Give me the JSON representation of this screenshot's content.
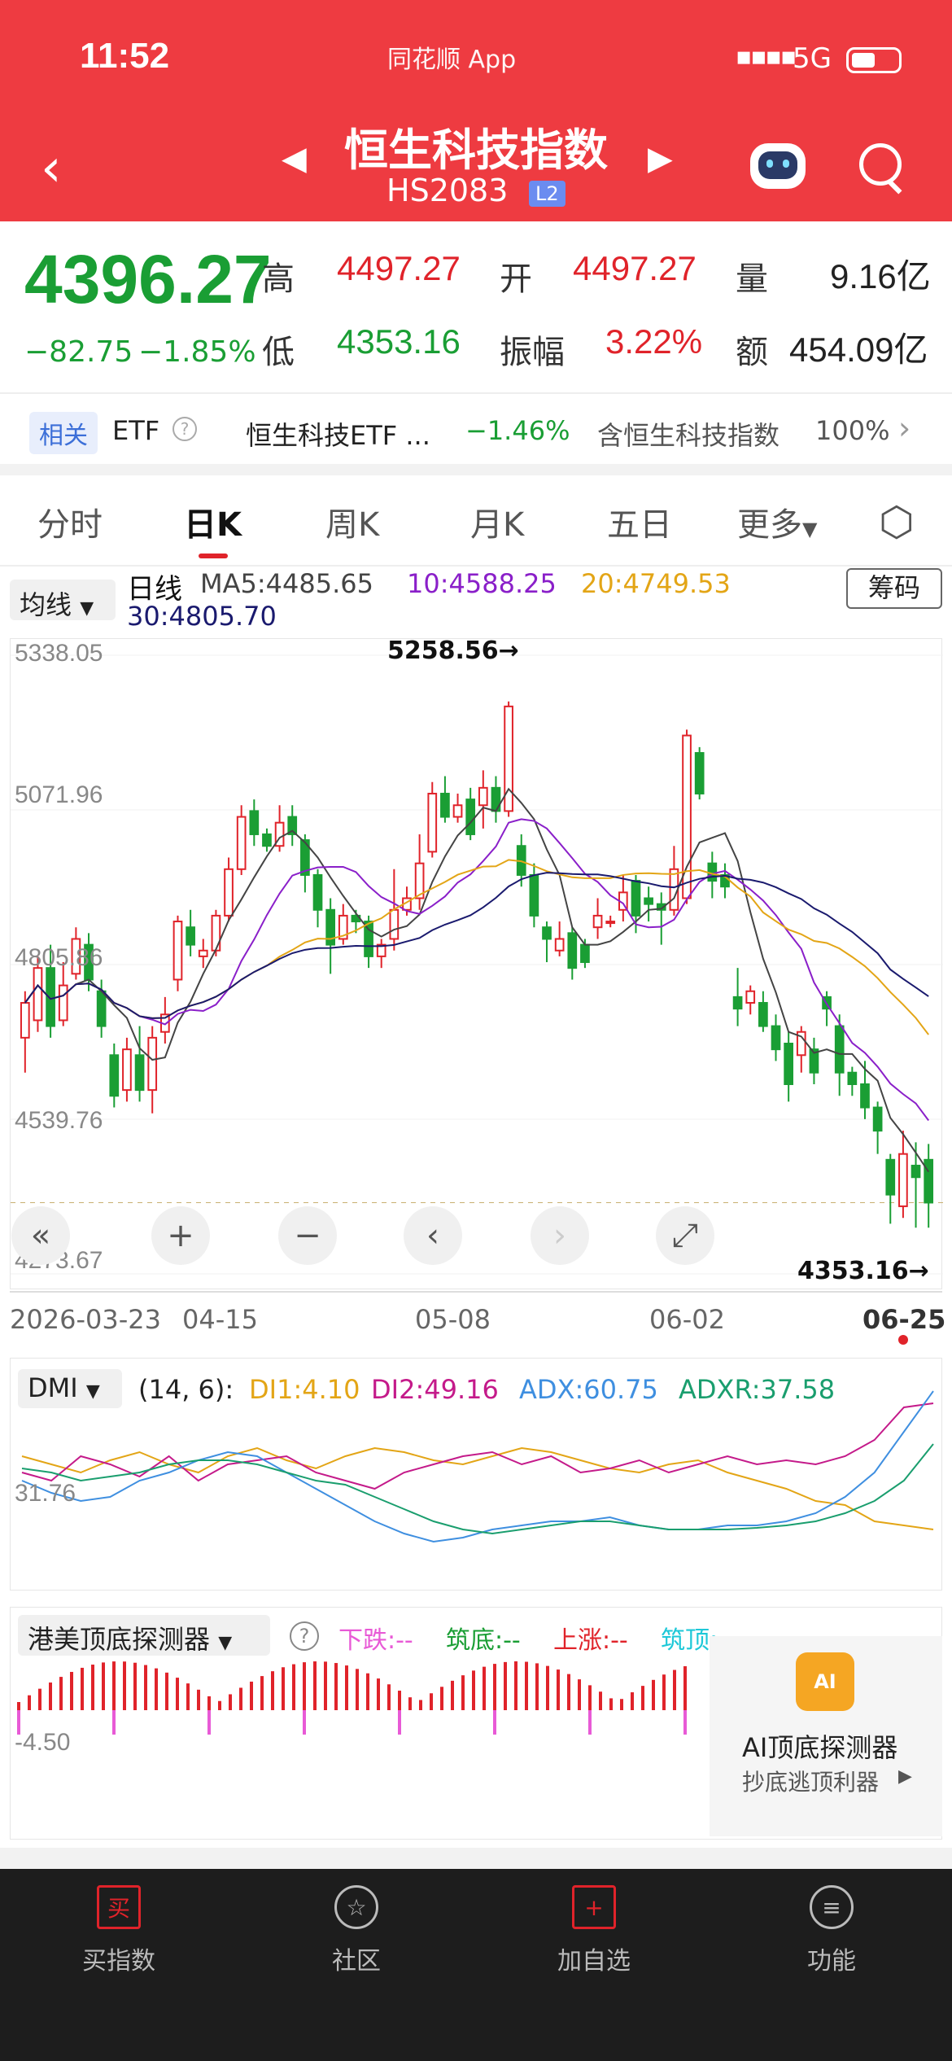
{
  "status": {
    "time": "11:52",
    "app_name": "同花顺 App",
    "network": "5G"
  },
  "header": {
    "title": "恒生科技指数",
    "code": "HS2083",
    "level_badge": "L2"
  },
  "quote": {
    "price": "4396.27",
    "change": "−82.75",
    "change_pct": "−1.85%",
    "high_label": "高",
    "high": "4497.27",
    "low_label": "低",
    "low": "4353.16",
    "open_label": "开",
    "open": "4497.27",
    "amp_label": "振幅",
    "amp": "3.22%",
    "vol_label": "量",
    "vol": "9.16亿",
    "amt_label": "额",
    "amt": "454.09亿"
  },
  "etf_row": {
    "tag": "相关",
    "etf_label": "ETF",
    "fund_name": "恒生科技ETF ...",
    "fund_change": "−1.46%",
    "holding_label": "含恒生科技指数",
    "holding_pct": "100%"
  },
  "tabs": [
    "分时",
    "日K",
    "周K",
    "月K",
    "五日",
    "更多"
  ],
  "ma_bar": {
    "select": "均线",
    "period": "日线",
    "ma5": "MA5:4485.65",
    "ma10": "10:4588.25",
    "ma20": "20:4749.53",
    "ma30": "30:4805.70",
    "chip_btn": "筹码"
  },
  "colors": {
    "up": "#e0232a",
    "down": "#1a9e34",
    "ma5": "#444444",
    "ma10": "#8a1fc9",
    "ma20": "#e3a516",
    "ma30": "#1a1a6e"
  },
  "chart_data": {
    "type": "candlestick",
    "y_ticks": [
      "5338.05",
      "5071.96",
      "4805.86",
      "4539.76",
      "4273.67"
    ],
    "ylim": [
      4273.67,
      5338.05
    ],
    "max_label": "5258.56→",
    "min_label": "4353.16→",
    "dates": [
      "2026-03-23",
      "04-15",
      "05-08",
      "06-02",
      "06-25"
    ],
    "candles": [
      [
        4680,
        4740,
        4620,
        4760
      ],
      [
        4710,
        4800,
        4690,
        4820
      ],
      [
        4800,
        4700,
        4680,
        4840
      ],
      [
        4710,
        4770,
        4700,
        4810
      ],
      [
        4790,
        4850,
        4780,
        4870
      ],
      [
        4840,
        4780,
        4760,
        4860
      ],
      [
        4760,
        4700,
        4680,
        4780
      ],
      [
        4650,
        4580,
        4560,
        4670
      ],
      [
        4590,
        4660,
        4570,
        4680
      ],
      [
        4650,
        4590,
        4570,
        4700
      ],
      [
        4590,
        4680,
        4550,
        4700
      ],
      [
        4690,
        4720,
        4670,
        4750
      ],
      [
        4780,
        4880,
        4760,
        4890
      ],
      [
        4870,
        4840,
        4820,
        4900
      ],
      [
        4820,
        4830,
        4800,
        4850
      ],
      [
        4830,
        4890,
        4820,
        4900
      ],
      [
        4890,
        4970,
        4880,
        4990
      ],
      [
        4970,
        5060,
        4960,
        5080
      ],
      [
        5070,
        5030,
        5010,
        5090
      ],
      [
        5030,
        5010,
        5000,
        5040
      ],
      [
        5010,
        5050,
        5000,
        5080
      ],
      [
        5060,
        5030,
        5010,
        5080
      ],
      [
        5020,
        4960,
        4930,
        5030
      ],
      [
        4960,
        4900,
        4870,
        4970
      ],
      [
        4900,
        4840,
        4790,
        4920
      ],
      [
        4850,
        4890,
        4840,
        4910
      ],
      [
        4890,
        4880,
        4860,
        4900
      ],
      [
        4880,
        4820,
        4800,
        4890
      ],
      [
        4820,
        4840,
        4800,
        4850
      ],
      [
        4850,
        4900,
        4830,
        4970
      ],
      [
        4900,
        4920,
        4890,
        4940
      ],
      [
        4920,
        4980,
        4900,
        5030
      ],
      [
        5000,
        5100,
        4990,
        5120
      ],
      [
        5100,
        5060,
        5050,
        5130
      ],
      [
        5060,
        5080,
        5050,
        5100
      ],
      [
        5090,
        5030,
        5020,
        5110
      ],
      [
        5080,
        5110,
        5040,
        5140
      ],
      [
        5110,
        5070,
        5050,
        5130
      ],
      [
        5070,
        5250,
        5060,
        5258.56
      ],
      [
        5010,
        4960,
        4940,
        5030
      ],
      [
        4960,
        4890,
        4870,
        4980
      ],
      [
        4870,
        4850,
        4810,
        4880
      ],
      [
        4830,
        4850,
        4820,
        4880
      ],
      [
        4860,
        4800,
        4780,
        4870
      ],
      [
        4840,
        4810,
        4800,
        4850
      ],
      [
        4870,
        4890,
        4850,
        4920
      ],
      [
        4880,
        4880,
        4870,
        4890
      ],
      [
        4900,
        4930,
        4880,
        4960
      ],
      [
        4950,
        4890,
        4860,
        4960
      ],
      [
        4920,
        4910,
        4880,
        4940
      ],
      [
        4910,
        4900,
        4840,
        4930
      ],
      [
        4900,
        4970,
        4890,
        5010
      ],
      [
        4920,
        5200,
        4910,
        5210
      ],
      [
        5170,
        5100,
        5090,
        5180
      ],
      [
        4980,
        4950,
        4920,
        5000
      ],
      [
        4960,
        4940,
        4920,
        4980
      ],
      [
        4750,
        4730,
        4700,
        4800
      ],
      [
        4740,
        4760,
        4720,
        4770
      ],
      [
        4740,
        4700,
        4690,
        4760
      ],
      [
        4700,
        4660,
        4640,
        4720
      ],
      [
        4670,
        4600,
        4570,
        4690
      ],
      [
        4650,
        4690,
        4620,
        4700
      ],
      [
        4660,
        4620,
        4600,
        4680
      ],
      [
        4750,
        4730,
        4700,
        4760
      ],
      [
        4700,
        4620,
        4580,
        4720
      ],
      [
        4620,
        4600,
        4580,
        4630
      ],
      [
        4600,
        4560,
        4540,
        4640
      ],
      [
        4560,
        4520,
        4480,
        4570
      ],
      [
        4470,
        4410,
        4360,
        4480
      ],
      [
        4390,
        4480,
        4370,
        4520
      ],
      [
        4460,
        4440,
        4353.16,
        4500
      ],
      [
        4470,
        4396.27,
        4353.16,
        4497.27
      ]
    ]
  },
  "chart_controls": {
    "zoom_in": "+",
    "zoom_out": "−"
  },
  "dmi": {
    "select": "DMI",
    "params": "(14, 6):",
    "di1": "DI1:4.10",
    "di2": "DI2:49.16",
    "adx": "ADX:60.75",
    "adxr": "ADXR:37.58",
    "y_tick": "31.76"
  },
  "detector": {
    "select": "港美顶底探测器",
    "down": "下跌:--",
    "bottom": "筑底:--",
    "up": "上涨:--",
    "top": "筑顶:--",
    "y_tick": "-4.50",
    "ai_title": "AI顶底探测器",
    "ai_sub": "抄底逃顶利器",
    "ai_badge": "AI"
  },
  "nav": [
    "买指数",
    "社区",
    "加自选",
    "功能"
  ],
  "nav_icons": [
    "buy-icon",
    "community-icon",
    "add-watchlist-icon",
    "menu-icon"
  ],
  "nav_glyphs": [
    "买",
    "☆",
    "+",
    "≡"
  ]
}
